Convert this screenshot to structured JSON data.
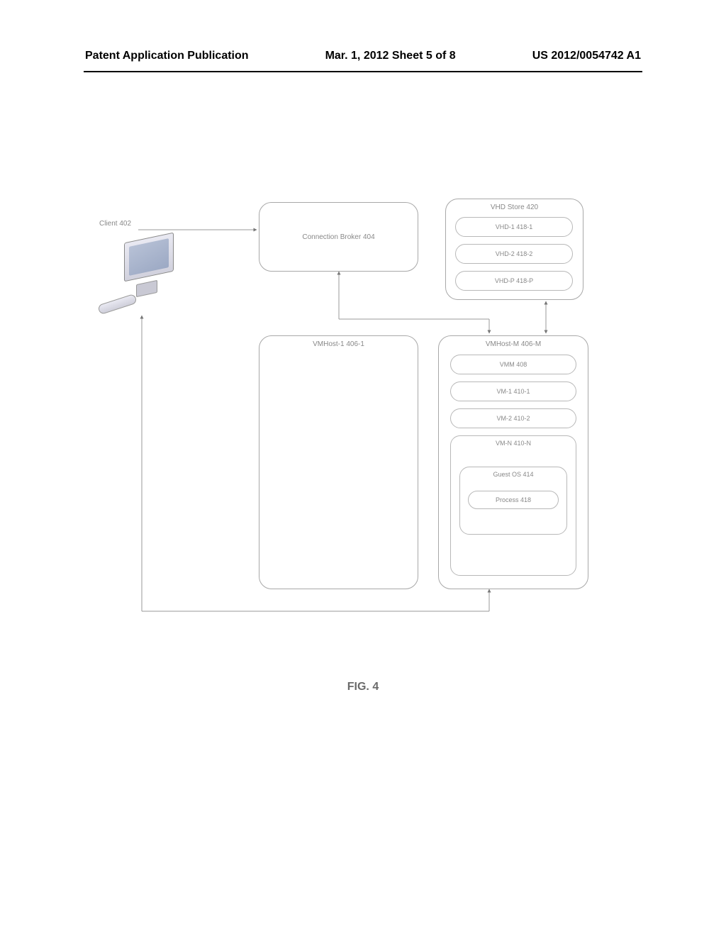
{
  "header": {
    "left": "Patent Application Publication",
    "center": "Mar. 1, 2012  Sheet 5 of 8",
    "right": "US 2012/0054742 A1"
  },
  "figure_label": "FIG. 4",
  "client_label": "Client 402",
  "connection_broker": "Connection Broker 404",
  "vhd_store": {
    "title": "VHD Store 420",
    "items": [
      "VHD-1 418-1",
      "VHD-2 418-2",
      "VHD-P 418-P"
    ]
  },
  "vmhost1": "VMHost-1 406-1",
  "vmhostM": {
    "title": "VMHost-M 406-M",
    "vmm": "VMM 408",
    "vm1": "VM-1 410-1",
    "vm2": "VM-2 410-2",
    "vmN": {
      "title": "VM-N 410-N",
      "guest": {
        "title": "Guest OS 414",
        "process": "Process 418"
      }
    }
  }
}
